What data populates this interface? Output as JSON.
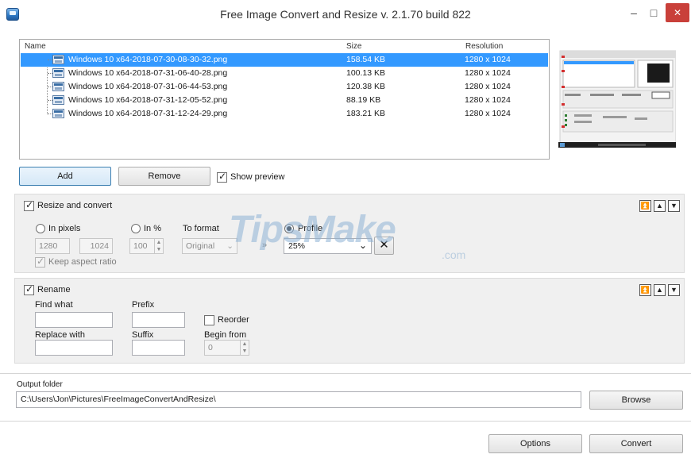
{
  "window": {
    "title": "Free Image Convert and Resize  v. 2.1.70 build 822",
    "minimize": "–",
    "maximize": "□",
    "close": "✕"
  },
  "file_list": {
    "columns": [
      "Name",
      "Size",
      "Resolution"
    ],
    "rows": [
      {
        "name": "Windows 10 x64-2018-07-30-08-30-32.png",
        "size": "158.54 KB",
        "resolution": "1280 x 1024",
        "selected": true
      },
      {
        "name": "Windows 10 x64-2018-07-31-06-40-28.png",
        "size": "100.13 KB",
        "resolution": "1280 x 1024",
        "selected": false
      },
      {
        "name": "Windows 10 x64-2018-07-31-06-44-53.png",
        "size": "120.38 KB",
        "resolution": "1280 x 1024",
        "selected": false
      },
      {
        "name": "Windows 10 x64-2018-07-31-12-05-52.png",
        "size": "88.19 KB",
        "resolution": "1280 x 1024",
        "selected": false
      },
      {
        "name": "Windows 10 x64-2018-07-31-12-24-29.png",
        "size": "183.21 KB",
        "resolution": "1280 x 1024",
        "selected": false
      }
    ]
  },
  "actions": {
    "add": "Add",
    "remove": "Remove",
    "show_preview": "Show preview",
    "show_preview_checked": true
  },
  "resize": {
    "title": "Resize and convert",
    "checked": true,
    "in_pixels": "In pixels",
    "in_percent": "In %",
    "to_format": "To format",
    "profile": "Profile",
    "width": "1280",
    "height": "1024",
    "percent": "100",
    "format": "Original",
    "arrow": "»",
    "profile_value": "25%",
    "keep_aspect": "Keep aspect ratio"
  },
  "rename": {
    "title": "Rename",
    "checked": true,
    "find_what": "Find what",
    "prefix": "Prefix",
    "reorder": "Reorder",
    "replace_with": "Replace with",
    "suffix": "Suffix",
    "begin_from": "Begin from",
    "begin_from_value": "0"
  },
  "output": {
    "label": "Output folder",
    "path": "C:\\Users\\Jon\\Pictures\\FreeImageConvertAndResize\\",
    "browse": "Browse"
  },
  "footer": {
    "options": "Options",
    "convert": "Convert"
  },
  "watermark": {
    "text": "TipsMake",
    "suffix": ".com"
  }
}
